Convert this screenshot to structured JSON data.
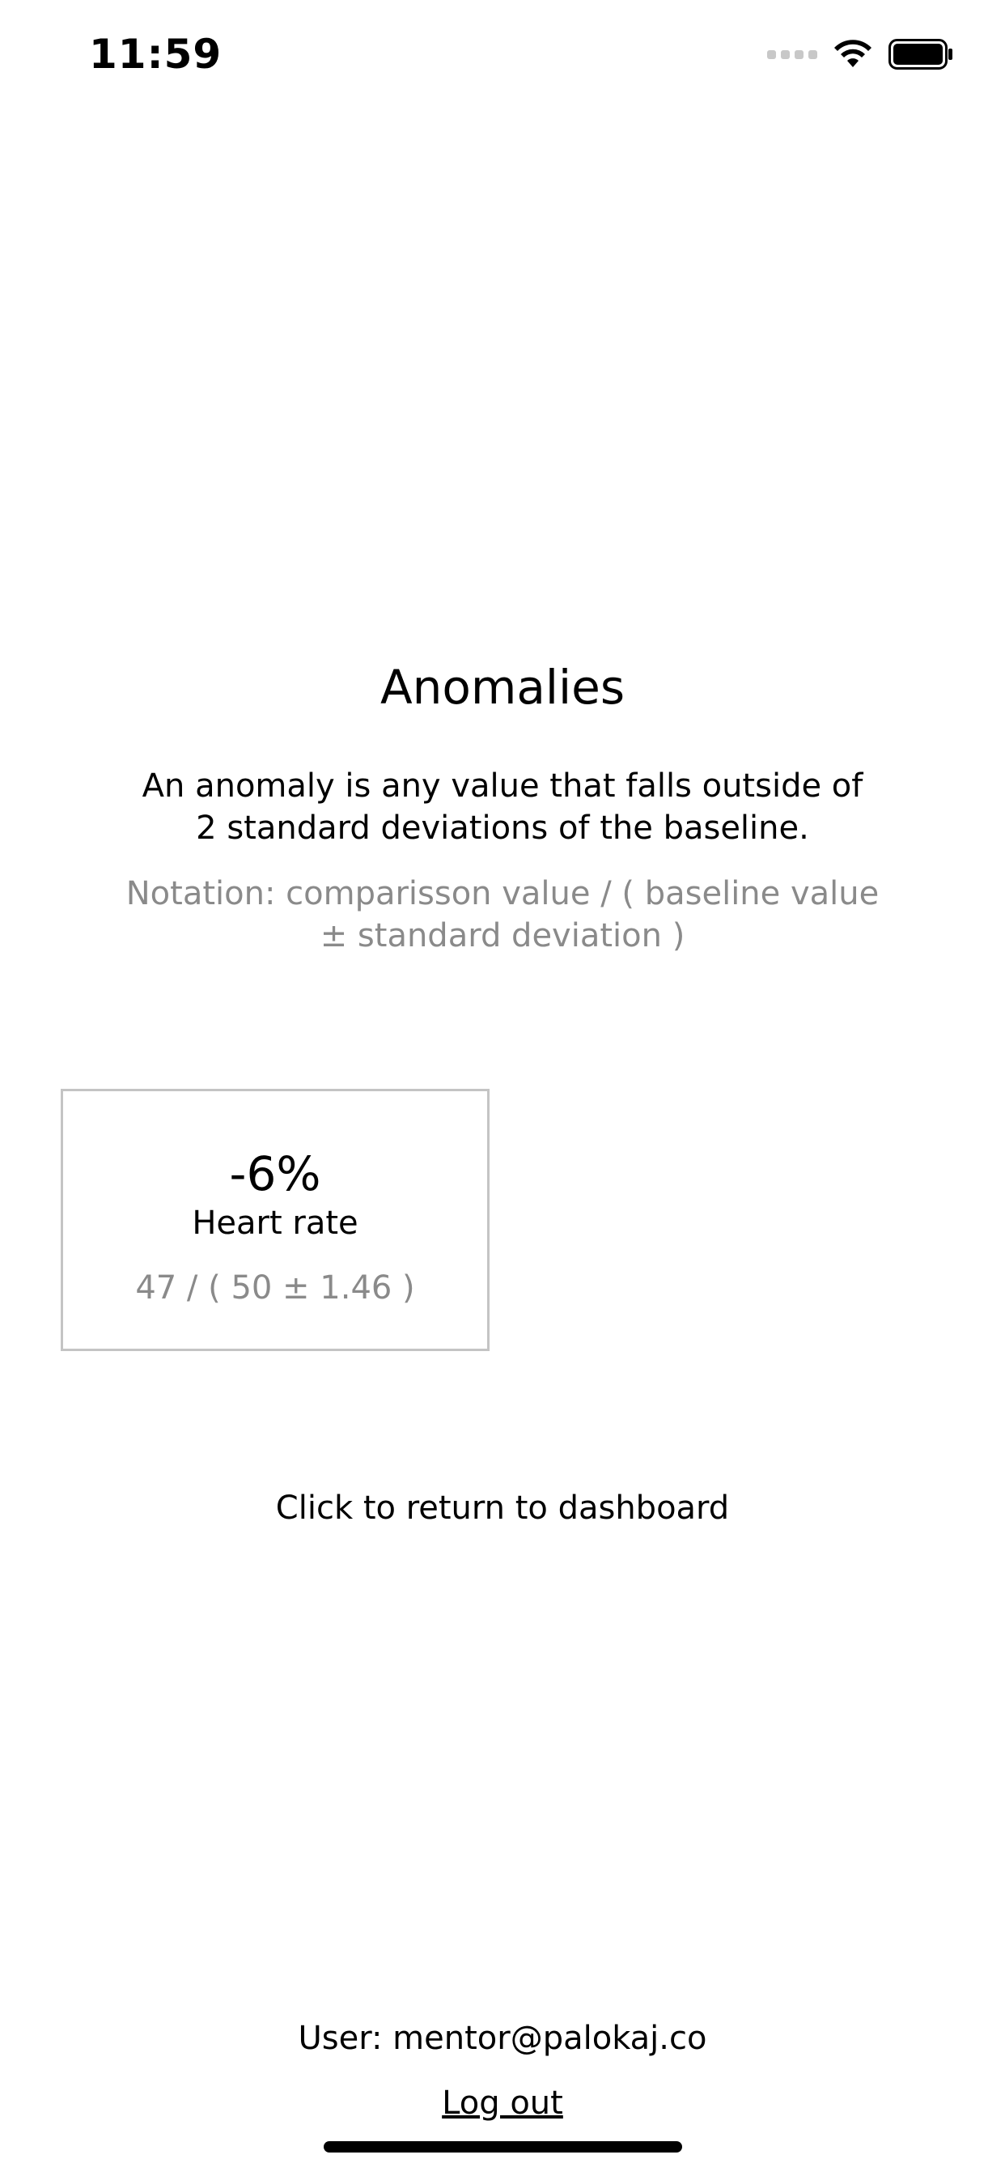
{
  "status_bar": {
    "time": "11:59",
    "icons": [
      "cellular-signal-icon",
      "wifi-icon",
      "battery-icon"
    ]
  },
  "page": {
    "title": "Anomalies",
    "description": "An anomaly is any value that falls outside of 2 standard deviations of the baseline.",
    "notation": "Notation: comparisson value / ( baseline value ± standard deviation )"
  },
  "anomalies": [
    {
      "percent": "-6%",
      "label": "Heart rate",
      "values": "47 / ( 50 ± 1.46 )"
    }
  ],
  "actions": {
    "return_label": "Click to return to dashboard",
    "user_text": "User: mentor@palokaj.co",
    "logout_label": "Log out"
  },
  "colors": {
    "text": "#000000",
    "muted_text": "#8a8a8a",
    "card_border": "#c4c4c4",
    "background": "#ffffff"
  }
}
